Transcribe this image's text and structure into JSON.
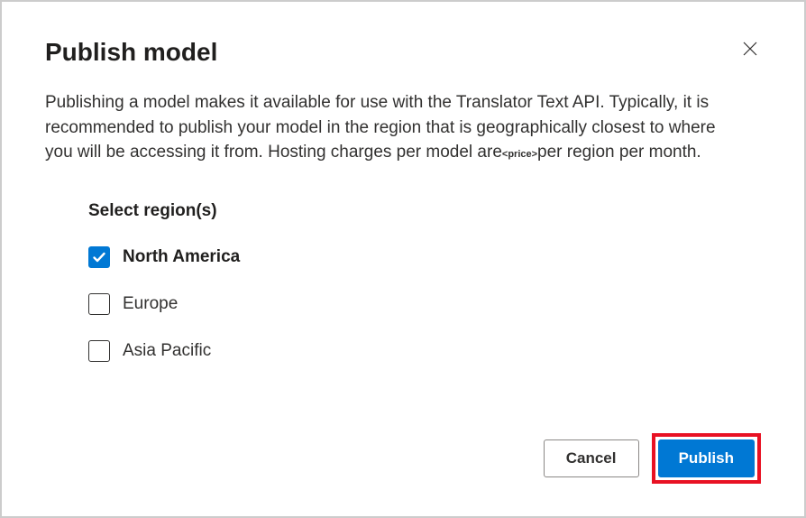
{
  "dialog": {
    "title": "Publish model",
    "description_pre": "Publishing a model makes it available for use with the Translator Text API. Typically, it is recommended to publish your model in the region that is geographically closest to where you will be accessing it from. Hosting charges per model are",
    "price_placeholder": "<price>",
    "description_post": "per region per month."
  },
  "regions": {
    "label": "Select region(s)",
    "items": [
      {
        "label": "North America",
        "checked": true
      },
      {
        "label": "Europe",
        "checked": false
      },
      {
        "label": "Asia Pacific",
        "checked": false
      }
    ]
  },
  "buttons": {
    "cancel": "Cancel",
    "publish": "Publish"
  }
}
